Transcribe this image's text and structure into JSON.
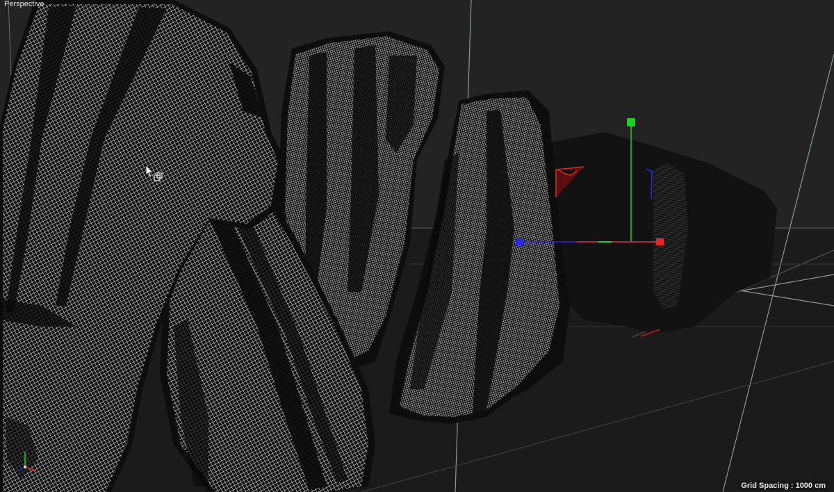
{
  "viewport": {
    "label": "Perspective",
    "grid_spacing": "Grid Spacing : 1000 cm"
  },
  "colors": {
    "background": "#232323",
    "floor": "#1b1b1b",
    "grid_line": "#8e9a96",
    "axis_x": "#e02828",
    "axis_y": "#20d020",
    "axis_z": "#2828e0",
    "mesh_wire": "#f2f2f2",
    "mesh_shadow": "#0c0c0c"
  },
  "gizmo": {
    "name": "move-manipulator",
    "handles": [
      "x-axis-handle",
      "y-axis-handle",
      "z-axis-handle"
    ]
  },
  "scene_objects": [
    {
      "name": "rock-mesh-1"
    },
    {
      "name": "rock-mesh-2"
    },
    {
      "name": "rock-mesh-3"
    },
    {
      "name": "rock-mesh-4"
    },
    {
      "name": "rock-mesh-5"
    }
  ]
}
